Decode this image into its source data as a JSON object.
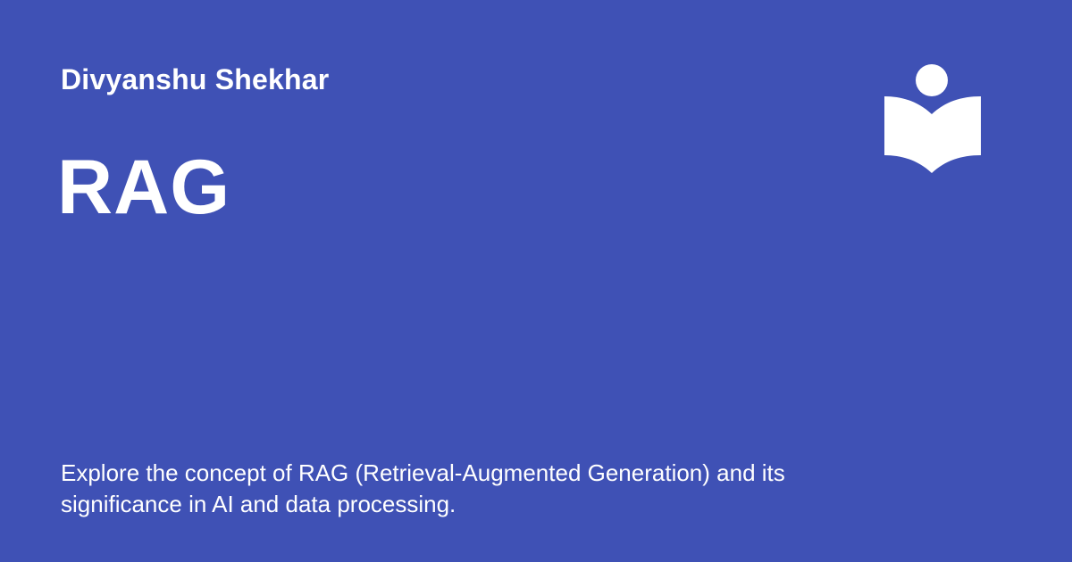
{
  "author": "Divyanshu Shekhar",
  "title": "RAG",
  "description": "Explore the concept of RAG (Retrieval-Augmented Generation) and its significance in AI and data processing.",
  "logo": {
    "icon": "person-reading-book-icon"
  },
  "colors": {
    "background": "#3f51b5",
    "text": "#ffffff"
  }
}
